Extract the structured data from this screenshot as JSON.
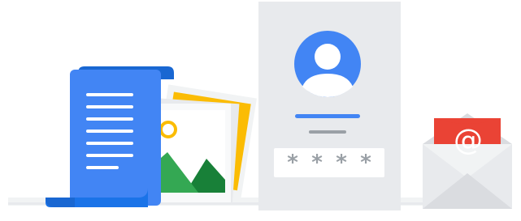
{
  "illustration": {
    "document_icon": "document-scroll-icon",
    "photos_icon": "photo-stack-icon",
    "account_card": {
      "avatar_icon": "user-avatar-icon",
      "password_mask": [
        "*",
        "*",
        "*",
        "*"
      ]
    },
    "email_icon": "envelope-at-icon",
    "at_symbol": "@"
  },
  "colors": {
    "blue": "#4285f4",
    "dark_blue": "#1a73e8",
    "yellow": "#fbbc04",
    "green": "#34a853",
    "dark_green": "#188038",
    "red": "#ea4335",
    "light_gray": "#e8eaed",
    "mid_gray": "#dadce0",
    "dark_gray": "#9aa0a6"
  }
}
